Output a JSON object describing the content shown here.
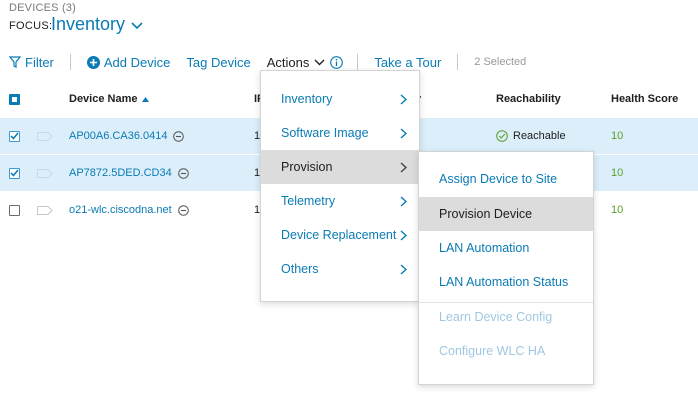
{
  "header": {
    "devices_label": "DEVICES (3)",
    "focus_label": "FOCUS:",
    "focus_value": "Inventory"
  },
  "toolbar": {
    "filter": "Filter",
    "add_device": "Add Device",
    "tag_device": "Tag Device",
    "actions": "Actions",
    "take_tour": "Take a Tour",
    "selected": "2 Selected"
  },
  "table": {
    "columns": [
      "Device Name",
      "IP",
      "ly",
      "Reachability",
      "Health Score"
    ],
    "rows": [
      {
        "name": "AP00A6.CA36.0414",
        "ip": "1",
        "reachability": "Reachable",
        "health": "10",
        "selected": true
      },
      {
        "name": "AP7872.5DED.CD34",
        "ip": "1",
        "reachability": "",
        "health": "10",
        "selected": true
      },
      {
        "name": "o21-wlc.ciscodna.net",
        "ip": "1",
        "reachability": "",
        "health": "10",
        "selected": false
      }
    ]
  },
  "actions_menu": {
    "items": [
      "Inventory",
      "Software Image",
      "Provision",
      "Telemetry",
      "Device Replacement",
      "Others"
    ],
    "highlighted": "Provision"
  },
  "provision_menu": {
    "items": [
      "Assign Device to Site",
      "Provision Device",
      "LAN Automation",
      "LAN Automation Status",
      "Learn Device Config",
      "Configure WLC HA"
    ],
    "highlighted": "Provision Device"
  },
  "colors": {
    "accent": "#0a7bb4",
    "selected_row": "#dbeef9",
    "health_good": "#5aa02c",
    "menu_highlight": "#dcdcdc"
  }
}
